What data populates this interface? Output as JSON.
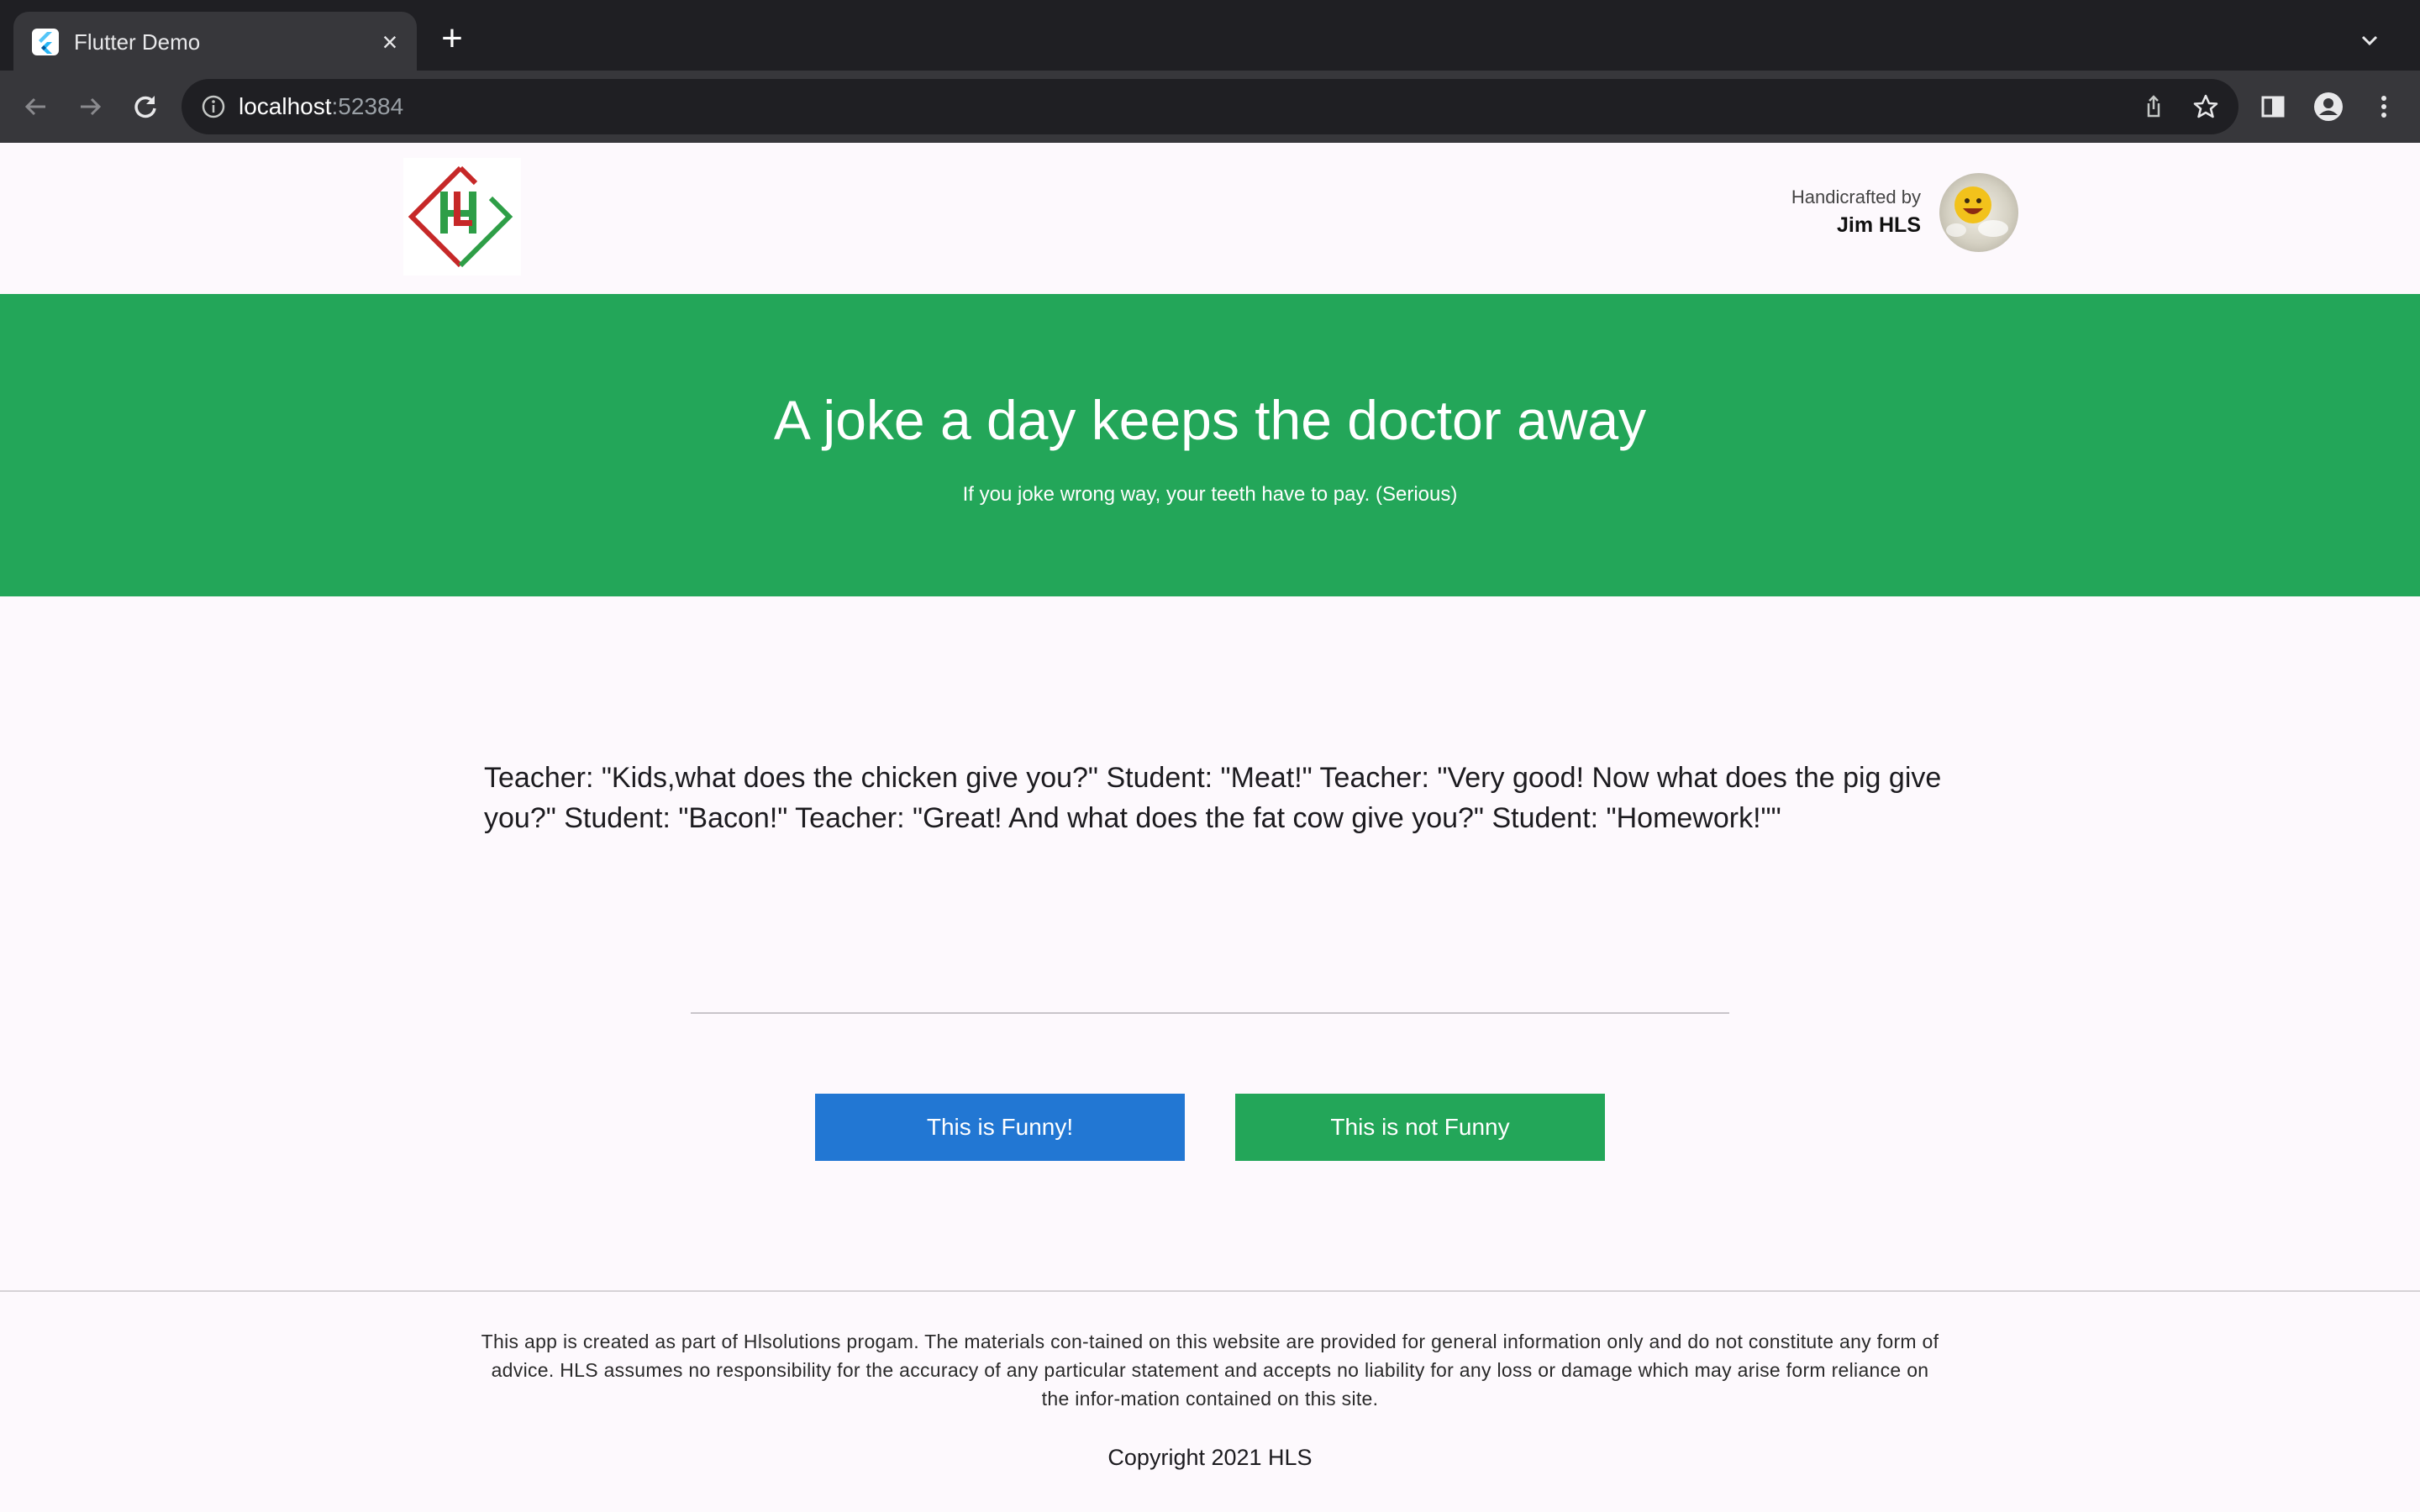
{
  "browser": {
    "tab_title": "Flutter Demo",
    "url_host": "localhost",
    "url_port": ":52384"
  },
  "header": {
    "credit_label": "Handicrafted by",
    "credit_name": "Jim HLS",
    "logo_letters": "HL"
  },
  "hero": {
    "title": "A joke a day keeps the doctor away",
    "subtitle": "If you joke wrong way, your teeth have to pay. (Serious)"
  },
  "joke": {
    "text": "Teacher: \"Kids,what does the chicken give you?\" Student: \"Meat!\" Teacher: \"Very good! Now what does the pig give you?\" Student: \"Bacon!\" Teacher: \"Great! And what does the fat cow give you?\" Student: \"Homework!\"\""
  },
  "actions": {
    "funny_label": "This is Funny!",
    "not_funny_label": "This is not Funny"
  },
  "footer": {
    "disclaimer": "This app is created as part of Hlsolutions progam. The materials con-tained on this website are provided for general information only and do not constitute any form of advice. HLS assumes no responsibility for the accuracy of any particular statement and accepts no liability for any loss or damage which may arise form reliance on the infor-mation contained on this site.",
    "copyright": "Copyright 2021 HLS"
  },
  "colors": {
    "brand_green": "#23a659",
    "funny_blue": "#2277d3",
    "logo_red": "#c62828",
    "logo_green": "#2e9e47"
  },
  "icons": [
    "flutter-favicon-icon",
    "close-icon",
    "plus-icon",
    "chevron-down-icon",
    "back-arrow-icon",
    "forward-arrow-icon",
    "reload-icon",
    "info-icon",
    "share-icon",
    "star-icon",
    "side-panel-icon",
    "profile-icon",
    "kebab-menu-icon"
  ]
}
